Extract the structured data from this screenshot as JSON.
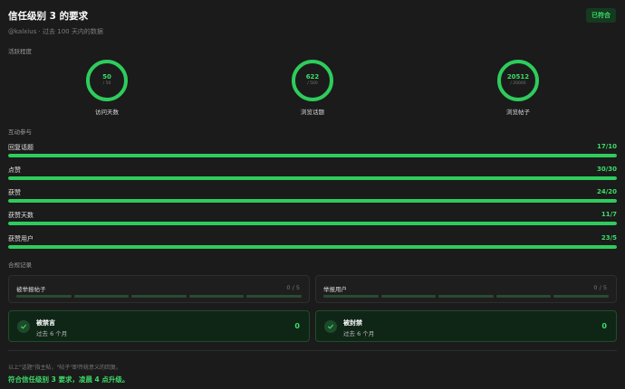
{
  "header": {
    "title": "信任级别 3 的要求",
    "badge": "已符合"
  },
  "subtitle": "@kalxius · 过去 100 天内的数据",
  "activity": {
    "label": "活跃程度",
    "rings": [
      {
        "value": "50",
        "target": "/ 50",
        "label": "访问天数",
        "progress": 1.0
      },
      {
        "value": "622",
        "target": "/ 500",
        "label": "浏览话题",
        "progress": 1.0
      },
      {
        "value": "20512",
        "target": "/ 20000",
        "label": "浏览帖子",
        "progress": 1.0
      }
    ]
  },
  "interaction": {
    "label": "互动参与",
    "bars": [
      {
        "label": "回复话题",
        "value": "17/10",
        "progress": 1.0
      },
      {
        "label": "点赞",
        "value": "30/30",
        "progress": 1.0
      },
      {
        "label": "获赞",
        "value": "24/20",
        "progress": 1.0
      },
      {
        "label": "获赞天数",
        "value": "11/7",
        "progress": 1.0
      },
      {
        "label": "获赞用户",
        "value": "23/5",
        "progress": 1.0
      }
    ]
  },
  "compliance": {
    "label": "合规记录",
    "reports": [
      {
        "label": "被举报帖子",
        "count": "0 / 5"
      },
      {
        "label": "举报用户",
        "count": "0 / 5"
      }
    ],
    "status": [
      {
        "title": "被禁言",
        "sub": "过去 6 个月",
        "value": "0"
      },
      {
        "title": "被封禁",
        "sub": "过去 6 个月",
        "value": "0"
      }
    ]
  },
  "footnote": "以上\"话题\"指主帖，\"帖子\"即传统意义的回复。",
  "summary": "符合信任级别 3 要求，凌晨 4 点升级。",
  "colors": {
    "accent": "#2ecc5c",
    "background": "#1b1b1b"
  }
}
